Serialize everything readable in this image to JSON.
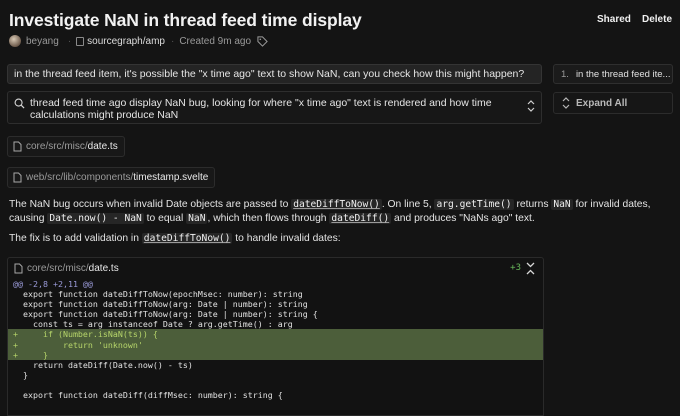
{
  "header": {
    "title": "Investigate NaN in thread feed time display",
    "shared_label": "Shared",
    "delete_label": "Delete",
    "author": "beyang",
    "repo": "sourcegraph/amp",
    "created": "Created 9m ago"
  },
  "prompt": {
    "text": "in the thread feed item, it's possible the \"x time ago\" text to show NaN, can you check how this might happen?"
  },
  "toc": {
    "number": "1.",
    "label": "in the thread feed ite..."
  },
  "expand_all_label": "Expand All",
  "search_step": {
    "text": "thread feed time ago display NaN bug, looking for where \"x time ago\" text is rendered and how time calculations might produce NaN"
  },
  "files": [
    {
      "dir": "core/src/misc/",
      "name": "date.ts"
    },
    {
      "dir": "web/src/lib/components/",
      "name": "timestamp.svelte"
    }
  ],
  "explanation": {
    "p1_a": "The NaN bug occurs when invalid Date objects are passed to ",
    "p1_code1": "dateDiffToNow()",
    "p1_b": ". On line 5, ",
    "p1_code2": "arg.getTime()",
    "p1_c": " returns ",
    "p1_code3": "NaN",
    "p1_d": " for invalid dates, causing ",
    "p1_code4": "Date.now() - NaN",
    "p1_e": " to equal ",
    "p1_code5": "NaN",
    "p1_f": ", which then flows through ",
    "p1_code6": "dateDiff()",
    "p1_g": " and produces \"NaNs ago\" text.",
    "p2_a": "The fix is to add validation in ",
    "p2_code": "dateDiffToNow()",
    "p2_b": " to handle invalid dates:"
  },
  "diff": {
    "dir": "core/src/misc/",
    "name": "date.ts",
    "added_count": "+3",
    "lines": [
      {
        "type": "hunk",
        "text": "@@ -2,8 +2,11 @@"
      },
      {
        "type": "ctx",
        "text": "  export function dateDiffToNow(epochMsec: number): string"
      },
      {
        "type": "ctx",
        "text": "  export function dateDiffToNow(arg: Date | number): string"
      },
      {
        "type": "ctx",
        "text": "  export function dateDiffToNow(arg: Date | number): string {"
      },
      {
        "type": "ctx",
        "text": "    const ts = arg instanceof Date ? arg.getTime() : arg"
      },
      {
        "type": "add",
        "text": "+     if (Number.isNaN(ts)) {"
      },
      {
        "type": "add",
        "text": "+         return 'unknown'"
      },
      {
        "type": "add",
        "text": "+     }"
      },
      {
        "type": "ctx",
        "text": "    return dateDiff(Date.now() - ts)"
      },
      {
        "type": "ctx",
        "text": "  }"
      },
      {
        "type": "ctx",
        "text": ""
      },
      {
        "type": "ctx",
        "text": "  export function dateDiff(diffMsec: number): string {"
      }
    ]
  },
  "colors": {
    "background": "#141414",
    "added_line_bg": "#4c5e3a",
    "added_line_text": "#b6d56a",
    "added_count": "#68b85a"
  }
}
